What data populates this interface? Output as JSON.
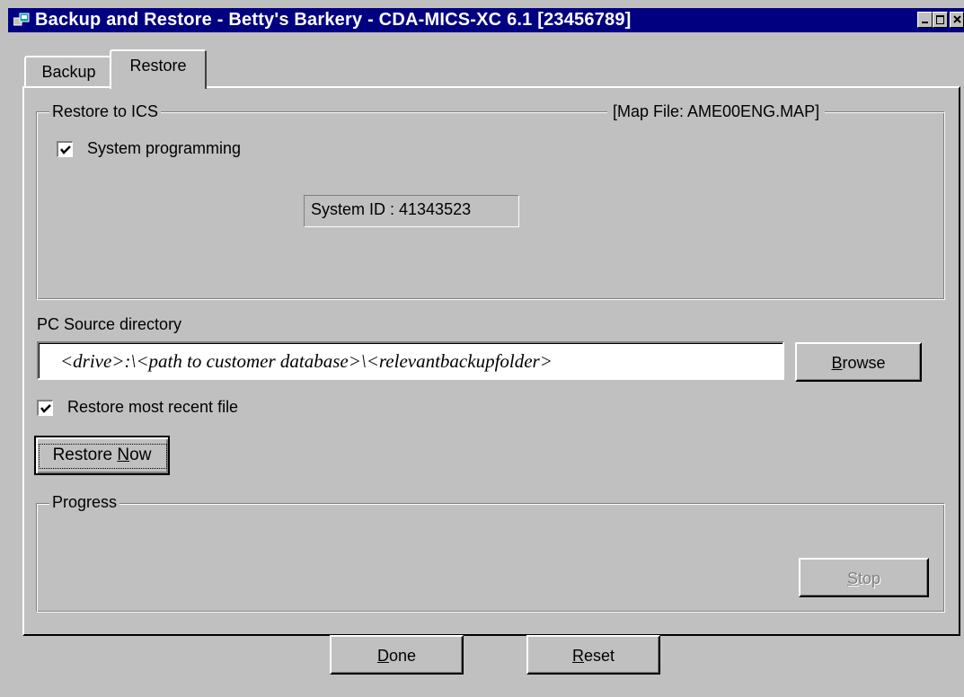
{
  "window": {
    "title": "Backup and Restore - Betty's Barkery - CDA-MICS-XC 6.1 [23456789]",
    "controls": [
      "minimize-icon",
      "maximize-icon",
      "close-icon"
    ]
  },
  "tabs": [
    {
      "label": "Backup",
      "selected": false
    },
    {
      "label": "Restore",
      "selected": true
    }
  ],
  "restore_group": {
    "legend": "Restore to ICS",
    "map_file": "[Map File:  AME00ENG.MAP]",
    "system_programming": {
      "label": "System programming",
      "checked": true
    },
    "system_id": "System ID : 41343523"
  },
  "source": {
    "label": "PC Source directory",
    "value": "<drive>:\\<path to customer database>\\<relevantbackupfolder>",
    "browse": {
      "pre": "",
      "mnemonic": "B",
      "post": "rowse"
    }
  },
  "restore_recent": {
    "label": "Restore most recent file",
    "checked": true
  },
  "restore_now": {
    "pre": "Restore ",
    "mnemonic": "N",
    "post": "ow"
  },
  "progress": {
    "legend": "Progress",
    "stop": {
      "pre": "",
      "mnemonic": "S",
      "post": "top",
      "enabled": false
    }
  },
  "footer": {
    "done": {
      "pre": "",
      "mnemonic": "D",
      "post": "one"
    },
    "reset": {
      "pre": "",
      "mnemonic": "R",
      "post": "eset"
    }
  },
  "colors": {
    "titlebar": "#000080",
    "face": "#c0c0c0",
    "shadow": "#808080",
    "highlight": "#ffffff"
  }
}
